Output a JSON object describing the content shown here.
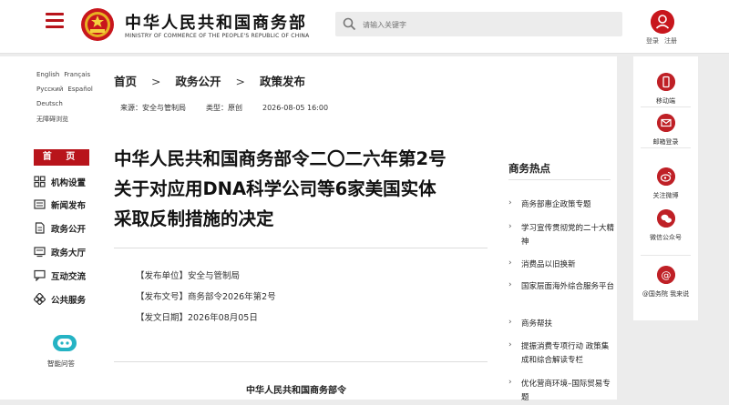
{
  "header": {
    "site_name_cn": "中华人民共和国商务部",
    "site_name_en": "MINISTRY OF COMMERCE OF THE PEOPLE'S REPUBLIC OF CHINA",
    "search_placeholder": "请输入关键字",
    "login_label": "登录",
    "register_label": "注册"
  },
  "languages": {
    "row1": [
      "English",
      "Français"
    ],
    "row2": [
      "Русский",
      "Español"
    ],
    "row3": [
      "Deutsch"
    ],
    "accessible": "无障碍浏览"
  },
  "leftnav": {
    "home": "首 页",
    "items": [
      {
        "label": "机构设置",
        "icon": "org-grid-icon"
      },
      {
        "label": "新闻发布",
        "icon": "news-icon"
      },
      {
        "label": "政务公开",
        "icon": "document-icon"
      },
      {
        "label": "政务大厅",
        "icon": "service-hall-icon"
      },
      {
        "label": "互动交流",
        "icon": "chat-icon"
      },
      {
        "label": "公共服务",
        "icon": "public-service-icon"
      }
    ],
    "qa_label": "智能问答"
  },
  "breadcrumb": {
    "items": [
      "首页",
      "政务公开",
      "政策发布"
    ],
    "separator": ">"
  },
  "meta": {
    "source": "来源：安全与管制局",
    "type": "类型：原创",
    "datetime": "2026-08-05 16:00"
  },
  "article": {
    "title_line1": "中华人民共和国商务部令二〇二六年第2号",
    "title_line2": "关于对应用DNA科学公司等6家美国实体",
    "title_line3": "采取反制措施的决定",
    "issuing_unit": "【发布单位】安全与管制局",
    "doc_number": "【发布文号】商务部令2026年第2号",
    "issue_date": "【发文日期】2026年08月05日",
    "issuer": "中华人民共和国商务部令"
  },
  "hot": {
    "title": "商务热点",
    "items": [
      "商务部惠企政策专题",
      "学习宣传贯彻党的二十大精神",
      "消费品以旧换新",
      "国家层面海外综合服务平台",
      "商务帮扶",
      "提振消费专项行动 政策集成和综合解读专栏",
      "优化营商环境–国际贸易专题"
    ]
  },
  "rightbar": {
    "items": [
      "移动端",
      "邮箱登录",
      "关注微博",
      "微信公众号",
      "@国务院 我来说"
    ]
  },
  "colors": {
    "brand_red": "#b8141b",
    "page_bg": "#ececec",
    "panel_bg": "#ffffff"
  }
}
